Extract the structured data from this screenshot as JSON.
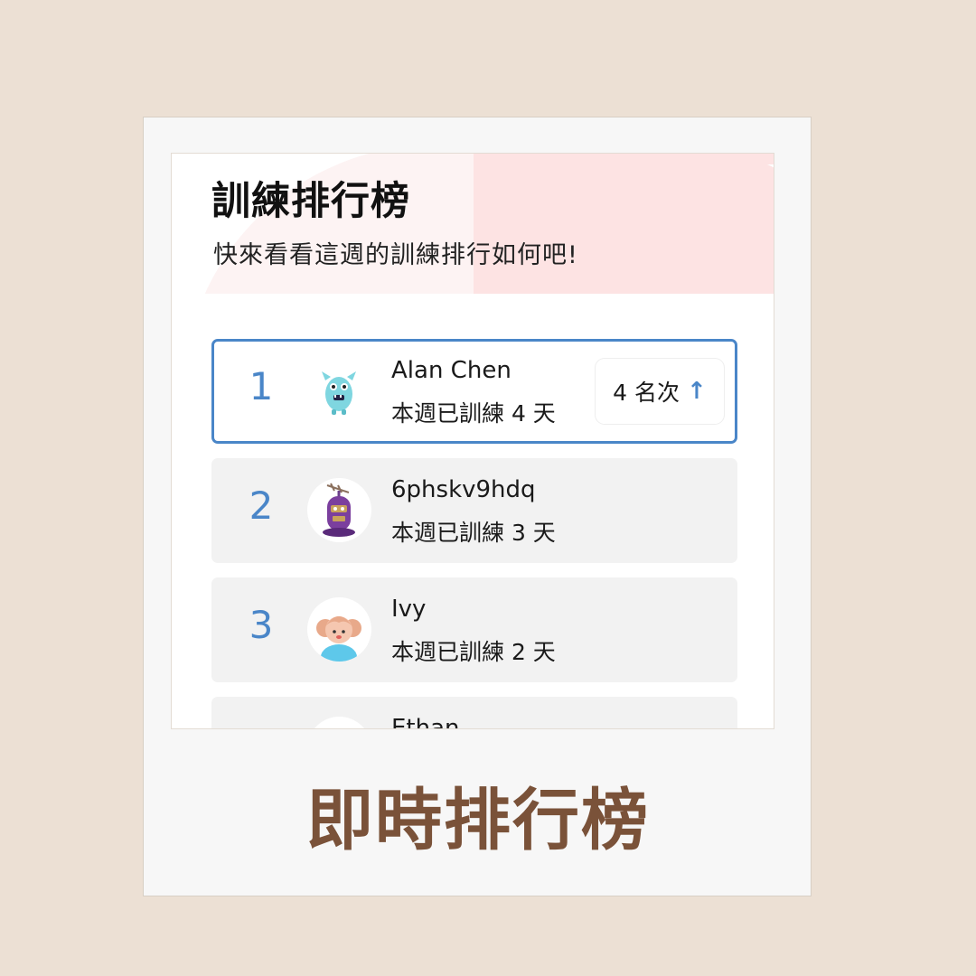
{
  "header": {
    "title": "訓練排行榜",
    "subtitle": "快來看看這週的訓練排行如何吧!"
  },
  "leaderboard": [
    {
      "rank": "1",
      "name": "Alan Chen",
      "days": "本週已訓練 4 天",
      "change": "4 名次",
      "avatar": "blue-monster-icon"
    },
    {
      "rank": "2",
      "name": "6phskv9hdq",
      "days": "本週已訓練 3 天",
      "avatar": "purple-robot-icon"
    },
    {
      "rank": "3",
      "name": "Ivy",
      "days": "本週已訓練 2 天",
      "avatar": "girl-icon"
    },
    {
      "name": "Ethan",
      "avatar": "avatar-icon"
    }
  ],
  "caption": "即時排行榜",
  "colors": {
    "accent": "#4a86c8",
    "caption": "#7a5239",
    "background": "#ece0d4"
  }
}
